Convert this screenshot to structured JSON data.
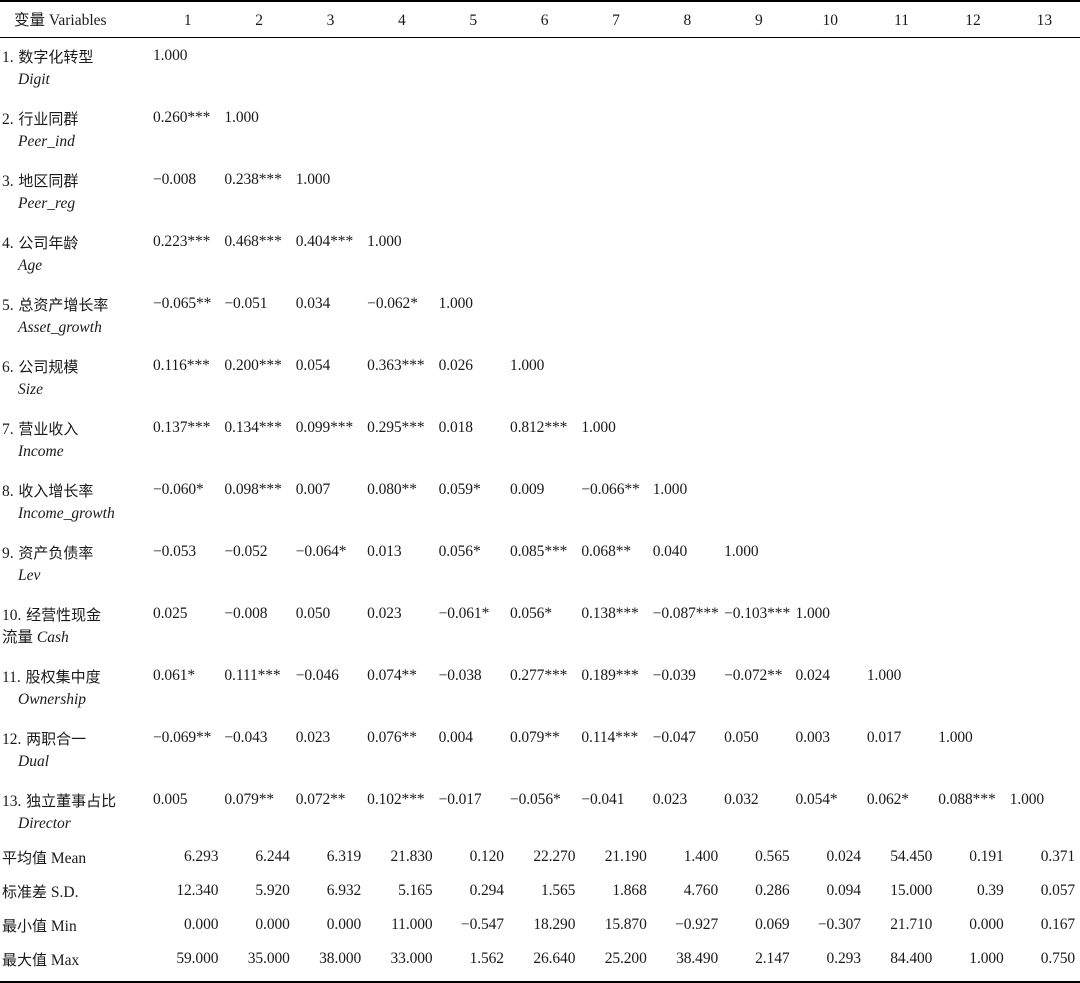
{
  "table": {
    "header": {
      "variables_label_cn": "变量",
      "variables_label_en": "Variables",
      "columns": [
        "1",
        "2",
        "3",
        "4",
        "5",
        "6",
        "7",
        "8",
        "9",
        "10",
        "11",
        "12",
        "13"
      ]
    },
    "rows": [
      {
        "index": "1.",
        "name_cn": "数字化转型",
        "name_en": "Digit",
        "values": [
          "1.000",
          "",
          "",
          "",
          "",
          "",
          "",
          "",
          "",
          "",
          "",
          "",
          ""
        ]
      },
      {
        "index": "2.",
        "name_cn": "行业同群",
        "name_en": "Peer_ind",
        "values": [
          "0.260***",
          "1.000",
          "",
          "",
          "",
          "",
          "",
          "",
          "",
          "",
          "",
          "",
          ""
        ]
      },
      {
        "index": "3.",
        "name_cn": "地区同群",
        "name_en": "Peer_reg",
        "values": [
          "−0.008",
          "0.238***",
          "1.000",
          "",
          "",
          "",
          "",
          "",
          "",
          "",
          "",
          "",
          ""
        ]
      },
      {
        "index": "4.",
        "name_cn": "公司年龄",
        "name_en": "Age",
        "values": [
          "0.223***",
          "0.468***",
          "0.404***",
          "1.000",
          "",
          "",
          "",
          "",
          "",
          "",
          "",
          "",
          ""
        ]
      },
      {
        "index": "5.",
        "name_cn": "总资产增长率",
        "name_en": "Asset_growth",
        "values": [
          "−0.065**",
          "−0.051",
          "0.034",
          "−0.062*",
          "1.000",
          "",
          "",
          "",
          "",
          "",
          "",
          "",
          ""
        ]
      },
      {
        "index": "6.",
        "name_cn": "公司规模",
        "name_en": "Size",
        "values": [
          "0.116***",
          "0.200***",
          "0.054",
          "0.363***",
          "0.026",
          "1.000",
          "",
          "",
          "",
          "",
          "",
          "",
          ""
        ]
      },
      {
        "index": "7.",
        "name_cn": "营业收入",
        "name_en": "Income",
        "values": [
          "0.137***",
          "0.134***",
          "0.099***",
          "0.295***",
          "0.018",
          "0.812***",
          "1.000",
          "",
          "",
          "",
          "",
          "",
          ""
        ]
      },
      {
        "index": "8.",
        "name_cn": "收入增长率",
        "name_en": "Income_growth",
        "values": [
          "−0.060*",
          "0.098***",
          "0.007",
          "0.080**",
          "0.059*",
          "0.009",
          "−0.066**",
          "1.000",
          "",
          "",
          "",
          "",
          ""
        ]
      },
      {
        "index": "9.",
        "name_cn": "资产负债率",
        "name_en": "Lev",
        "values": [
          "−0.053",
          "−0.052",
          "−0.064*",
          "0.013",
          "0.056*",
          "0.085***",
          "0.068**",
          "0.040",
          "1.000",
          "",
          "",
          "",
          ""
        ]
      },
      {
        "index": "10.",
        "name_cn": "经营性现金",
        "name_cn2": "流量",
        "name_en": "Cash",
        "wrap": true,
        "values": [
          "0.025",
          "−0.008",
          "0.050",
          "0.023",
          "−0.061*",
          "0.056*",
          "0.138***",
          "−0.087***",
          "−0.103***",
          "1.000",
          "",
          "",
          ""
        ]
      },
      {
        "index": "11.",
        "name_cn": "股权集中度",
        "name_en": "Ownership",
        "values": [
          "0.061*",
          "0.111***",
          "−0.046",
          "0.074**",
          "−0.038",
          "0.277***",
          "0.189***",
          "−0.039",
          "−0.072**",
          "0.024",
          "1.000",
          "",
          ""
        ]
      },
      {
        "index": "12.",
        "name_cn": "两职合一",
        "name_en": "Dual",
        "values": [
          "−0.069**",
          "−0.043",
          "0.023",
          "0.076**",
          "0.004",
          "0.079**",
          "0.114***",
          "−0.047",
          "0.050",
          "0.003",
          "0.017",
          "1.000",
          ""
        ]
      },
      {
        "index": "13.",
        "name_cn": "独立董事占比",
        "name_en": "Director",
        "values": [
          "0.005",
          "0.079**",
          "0.072**",
          "0.102***",
          "−0.017",
          "−0.056*",
          "−0.041",
          "0.023",
          "0.032",
          "0.054*",
          "0.062*",
          "0.088***",
          "1.000"
        ]
      }
    ],
    "stats": [
      {
        "label_cn": "平均值",
        "label_en": "Mean",
        "values": [
          "6.293",
          "6.244",
          "6.319",
          "21.830",
          "0.120",
          "22.270",
          "21.190",
          "1.400",
          "0.565",
          "0.024",
          "54.450",
          "0.191",
          "0.371"
        ]
      },
      {
        "label_cn": "标准差",
        "label_en": "S.D.",
        "values": [
          "12.340",
          "5.920",
          "6.932",
          "5.165",
          "0.294",
          "1.565",
          "1.868",
          "4.760",
          "0.286",
          "0.094",
          "15.000",
          "0.39",
          "0.057"
        ]
      },
      {
        "label_cn": "最小值",
        "label_en": "Min",
        "values": [
          "0.000",
          "0.000",
          "0.000",
          "11.000",
          "−0.547",
          "18.290",
          "15.870",
          "−0.927",
          "0.069",
          "−0.307",
          "21.710",
          "0.000",
          "0.167"
        ]
      },
      {
        "label_cn": "最大值",
        "label_en": "Max",
        "values": [
          "59.000",
          "35.000",
          "38.000",
          "33.000",
          "1.562",
          "26.640",
          "25.200",
          "38.490",
          "2.147",
          "0.293",
          "84.400",
          "1.000",
          "0.750"
        ]
      }
    ]
  }
}
